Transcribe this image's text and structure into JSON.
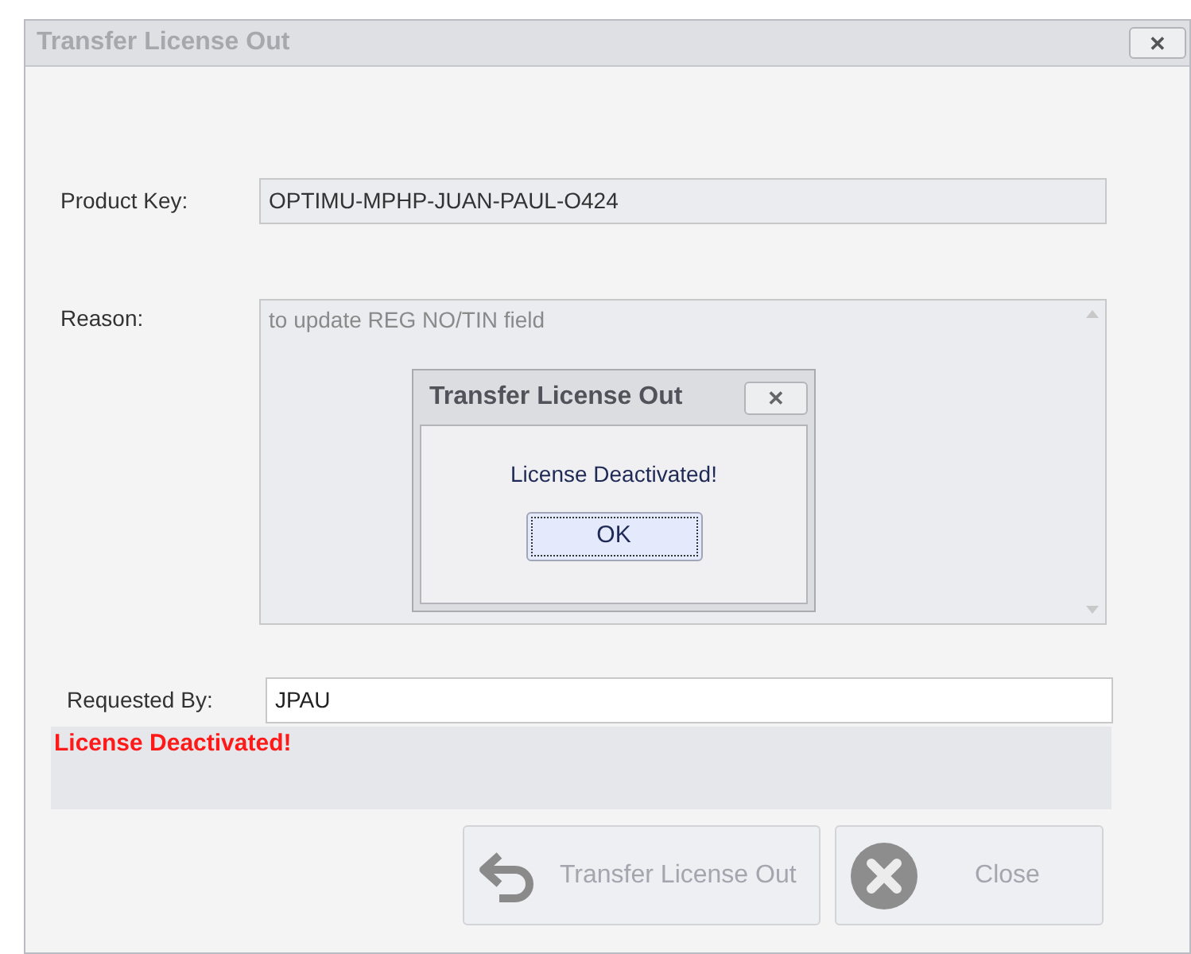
{
  "window": {
    "title": "Transfer License Out",
    "close": "✕"
  },
  "fields": [
    {
      "label": "Product Key:",
      "value": "OPTIMU-MPHP-JUAN-PAUL-O424",
      "disabled": true
    },
    {
      "label": "Reason:",
      "value": "to update REG NO/TIN field",
      "disabled": true
    },
    {
      "label": "Requested By:",
      "value": "JPAU",
      "disabled": false
    }
  ],
  "status_message": "License Deactivated!",
  "buttons": [
    {
      "label": "Transfer License Out",
      "kind": "transfer",
      "disabled": true
    },
    {
      "label": "Close",
      "kind": "close",
      "disabled": true
    }
  ],
  "message_box": {
    "title": "Transfer License Out",
    "close": "✕",
    "message": "License Deactivated!",
    "button": "OK"
  }
}
